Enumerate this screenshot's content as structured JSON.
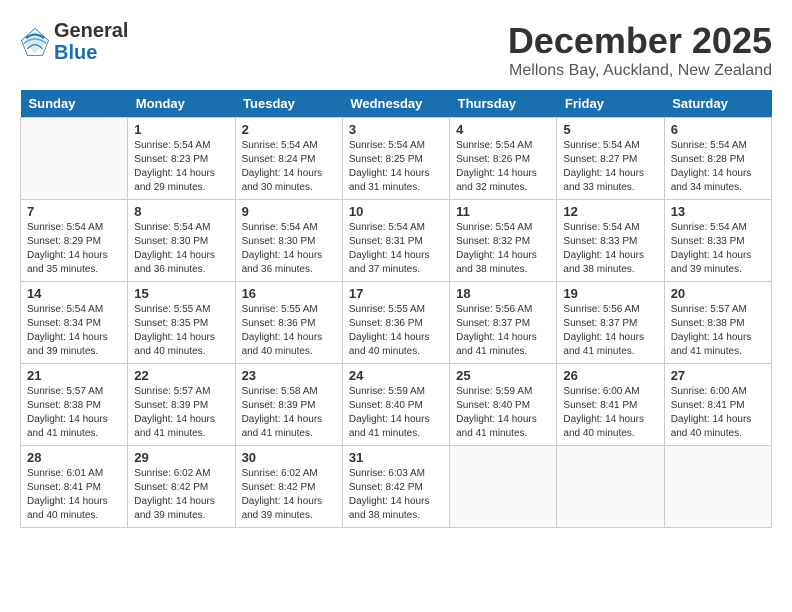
{
  "logo": {
    "general": "General",
    "blue": "Blue"
  },
  "title": "December 2025",
  "subtitle": "Mellons Bay, Auckland, New Zealand",
  "days_header": [
    "Sunday",
    "Monday",
    "Tuesday",
    "Wednesday",
    "Thursday",
    "Friday",
    "Saturday"
  ],
  "weeks": [
    [
      {
        "day": "",
        "info": ""
      },
      {
        "day": "1",
        "info": "Sunrise: 5:54 AM\nSunset: 8:23 PM\nDaylight: 14 hours\nand 29 minutes."
      },
      {
        "day": "2",
        "info": "Sunrise: 5:54 AM\nSunset: 8:24 PM\nDaylight: 14 hours\nand 30 minutes."
      },
      {
        "day": "3",
        "info": "Sunrise: 5:54 AM\nSunset: 8:25 PM\nDaylight: 14 hours\nand 31 minutes."
      },
      {
        "day": "4",
        "info": "Sunrise: 5:54 AM\nSunset: 8:26 PM\nDaylight: 14 hours\nand 32 minutes."
      },
      {
        "day": "5",
        "info": "Sunrise: 5:54 AM\nSunset: 8:27 PM\nDaylight: 14 hours\nand 33 minutes."
      },
      {
        "day": "6",
        "info": "Sunrise: 5:54 AM\nSunset: 8:28 PM\nDaylight: 14 hours\nand 34 minutes."
      }
    ],
    [
      {
        "day": "7",
        "info": "Sunrise: 5:54 AM\nSunset: 8:29 PM\nDaylight: 14 hours\nand 35 minutes."
      },
      {
        "day": "8",
        "info": "Sunrise: 5:54 AM\nSunset: 8:30 PM\nDaylight: 14 hours\nand 36 minutes."
      },
      {
        "day": "9",
        "info": "Sunrise: 5:54 AM\nSunset: 8:30 PM\nDaylight: 14 hours\nand 36 minutes."
      },
      {
        "day": "10",
        "info": "Sunrise: 5:54 AM\nSunset: 8:31 PM\nDaylight: 14 hours\nand 37 minutes."
      },
      {
        "day": "11",
        "info": "Sunrise: 5:54 AM\nSunset: 8:32 PM\nDaylight: 14 hours\nand 38 minutes."
      },
      {
        "day": "12",
        "info": "Sunrise: 5:54 AM\nSunset: 8:33 PM\nDaylight: 14 hours\nand 38 minutes."
      },
      {
        "day": "13",
        "info": "Sunrise: 5:54 AM\nSunset: 8:33 PM\nDaylight: 14 hours\nand 39 minutes."
      }
    ],
    [
      {
        "day": "14",
        "info": "Sunrise: 5:54 AM\nSunset: 8:34 PM\nDaylight: 14 hours\nand 39 minutes."
      },
      {
        "day": "15",
        "info": "Sunrise: 5:55 AM\nSunset: 8:35 PM\nDaylight: 14 hours\nand 40 minutes."
      },
      {
        "day": "16",
        "info": "Sunrise: 5:55 AM\nSunset: 8:36 PM\nDaylight: 14 hours\nand 40 minutes."
      },
      {
        "day": "17",
        "info": "Sunrise: 5:55 AM\nSunset: 8:36 PM\nDaylight: 14 hours\nand 40 minutes."
      },
      {
        "day": "18",
        "info": "Sunrise: 5:56 AM\nSunset: 8:37 PM\nDaylight: 14 hours\nand 41 minutes."
      },
      {
        "day": "19",
        "info": "Sunrise: 5:56 AM\nSunset: 8:37 PM\nDaylight: 14 hours\nand 41 minutes."
      },
      {
        "day": "20",
        "info": "Sunrise: 5:57 AM\nSunset: 8:38 PM\nDaylight: 14 hours\nand 41 minutes."
      }
    ],
    [
      {
        "day": "21",
        "info": "Sunrise: 5:57 AM\nSunset: 8:38 PM\nDaylight: 14 hours\nand 41 minutes."
      },
      {
        "day": "22",
        "info": "Sunrise: 5:57 AM\nSunset: 8:39 PM\nDaylight: 14 hours\nand 41 minutes."
      },
      {
        "day": "23",
        "info": "Sunrise: 5:58 AM\nSunset: 8:39 PM\nDaylight: 14 hours\nand 41 minutes."
      },
      {
        "day": "24",
        "info": "Sunrise: 5:59 AM\nSunset: 8:40 PM\nDaylight: 14 hours\nand 41 minutes."
      },
      {
        "day": "25",
        "info": "Sunrise: 5:59 AM\nSunset: 8:40 PM\nDaylight: 14 hours\nand 41 minutes."
      },
      {
        "day": "26",
        "info": "Sunrise: 6:00 AM\nSunset: 8:41 PM\nDaylight: 14 hours\nand 40 minutes."
      },
      {
        "day": "27",
        "info": "Sunrise: 6:00 AM\nSunset: 8:41 PM\nDaylight: 14 hours\nand 40 minutes."
      }
    ],
    [
      {
        "day": "28",
        "info": "Sunrise: 6:01 AM\nSunset: 8:41 PM\nDaylight: 14 hours\nand 40 minutes."
      },
      {
        "day": "29",
        "info": "Sunrise: 6:02 AM\nSunset: 8:42 PM\nDaylight: 14 hours\nand 39 minutes."
      },
      {
        "day": "30",
        "info": "Sunrise: 6:02 AM\nSunset: 8:42 PM\nDaylight: 14 hours\nand 39 minutes."
      },
      {
        "day": "31",
        "info": "Sunrise: 6:03 AM\nSunset: 8:42 PM\nDaylight: 14 hours\nand 38 minutes."
      },
      {
        "day": "",
        "info": ""
      },
      {
        "day": "",
        "info": ""
      },
      {
        "day": "",
        "info": ""
      }
    ]
  ]
}
